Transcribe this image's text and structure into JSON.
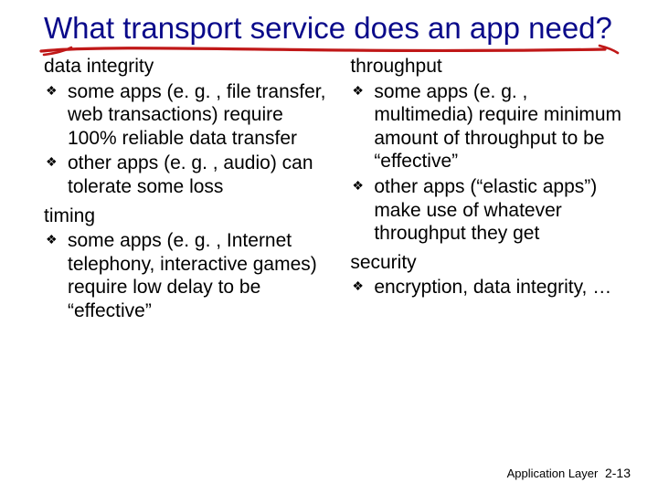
{
  "title": "What transport service does an app need?",
  "left": {
    "sections": [
      {
        "heading": "data integrity",
        "items": [
          "some apps (e. g. , file transfer, web transactions) require 100% reliable data transfer",
          "other apps (e. g. , audio) can tolerate some loss"
        ]
      },
      {
        "heading": "timing",
        "items": [
          "some apps (e. g. , Internet telephony, interactive games) require low delay to be “effective”"
        ]
      }
    ]
  },
  "right": {
    "sections": [
      {
        "heading": "throughput",
        "items": [
          "some apps (e. g. , multimedia) require minimum amount of throughput to be “effective”",
          "other apps (“elastic apps”) make use of whatever throughput they get"
        ]
      },
      {
        "heading": "security",
        "items": [
          "encryption, data integrity, …"
        ]
      }
    ]
  },
  "footer": {
    "label": "Application Layer",
    "page": "2-13"
  },
  "colors": {
    "title": "#0a0a8a",
    "underline": "#c01818"
  }
}
